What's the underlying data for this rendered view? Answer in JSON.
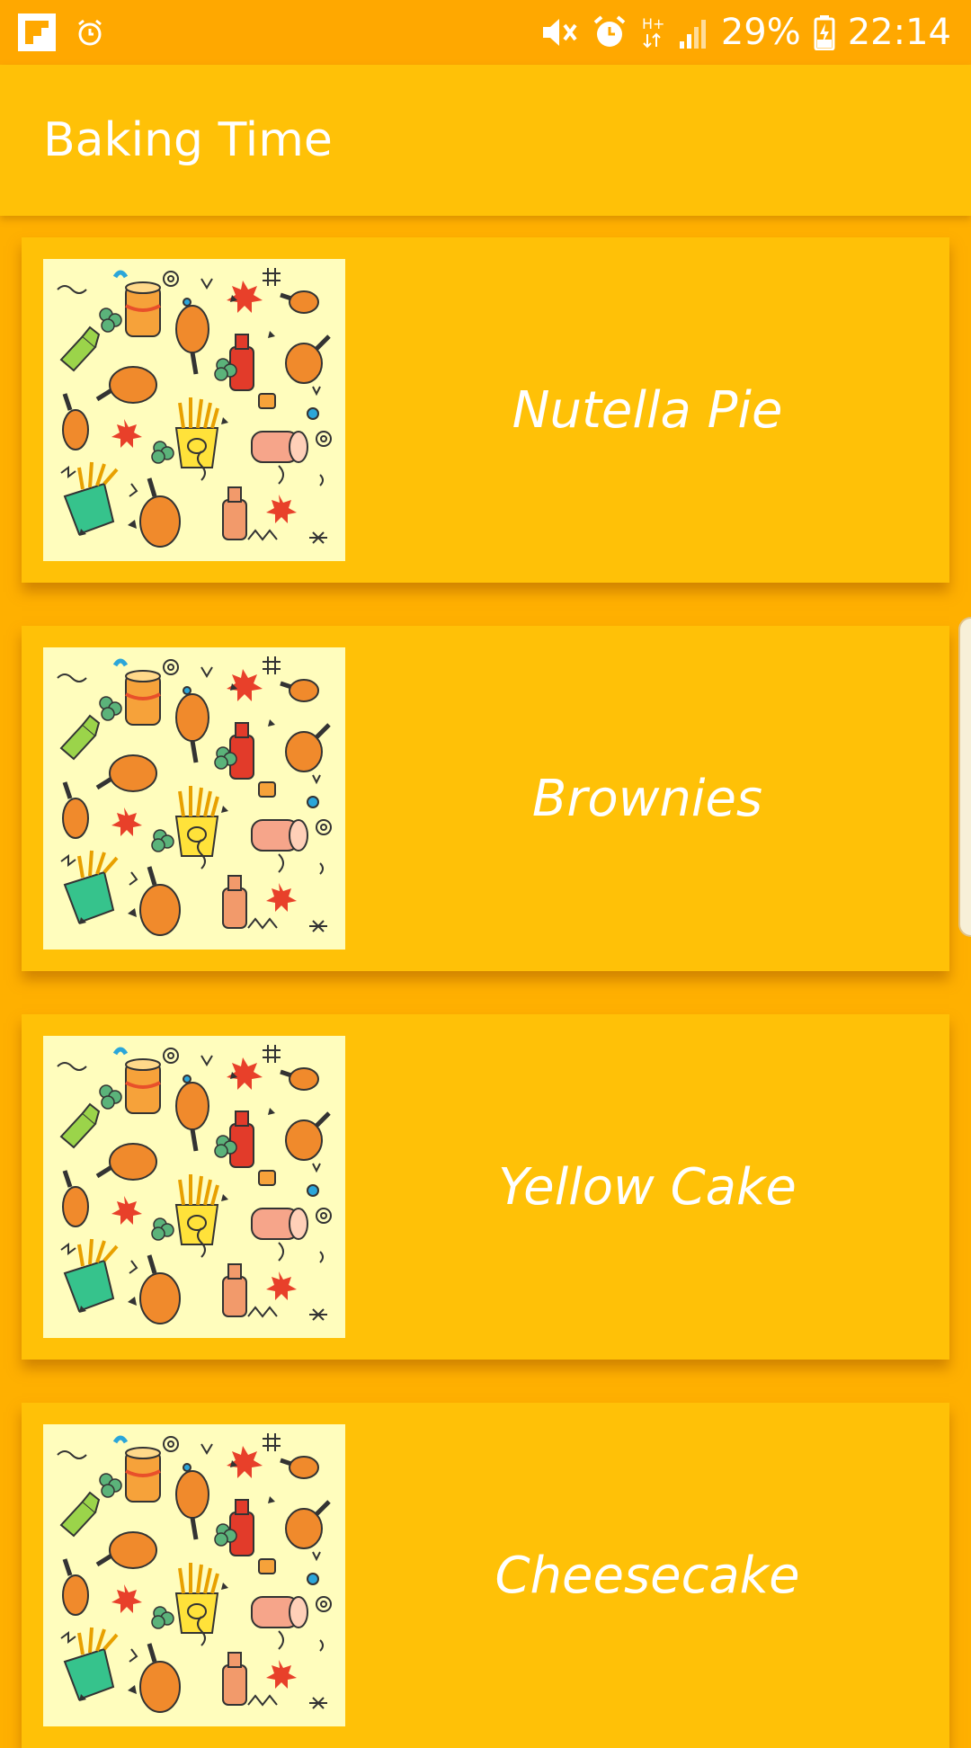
{
  "status_bar": {
    "left_icons": [
      "flipboard-icon",
      "alarm-clock-icon"
    ],
    "right_icons": [
      "vibrate-mute-icon",
      "alarm-icon",
      "network-hplus-icon",
      "signal-icon",
      "battery-charging-icon"
    ],
    "network_type": "H+",
    "battery_percent": "29%",
    "time": "22:14"
  },
  "app_bar": {
    "title": "Baking Time"
  },
  "recipes": [
    {
      "name": "Nutella Pie",
      "thumbnail_icon": "food-doodle-pattern-icon"
    },
    {
      "name": "Brownies",
      "thumbnail_icon": "food-doodle-pattern-icon"
    },
    {
      "name": "Yellow Cake",
      "thumbnail_icon": "food-doodle-pattern-icon"
    },
    {
      "name": "Cheesecake",
      "thumbnail_icon": "food-doodle-pattern-icon"
    }
  ],
  "colors": {
    "status_bar": "#FFA800",
    "app_bar": "#FFC107",
    "background": "#FFB000",
    "card": "#FFC107",
    "thumbnail_bg": "#FFFDBD",
    "text": "#FFFFFF"
  }
}
